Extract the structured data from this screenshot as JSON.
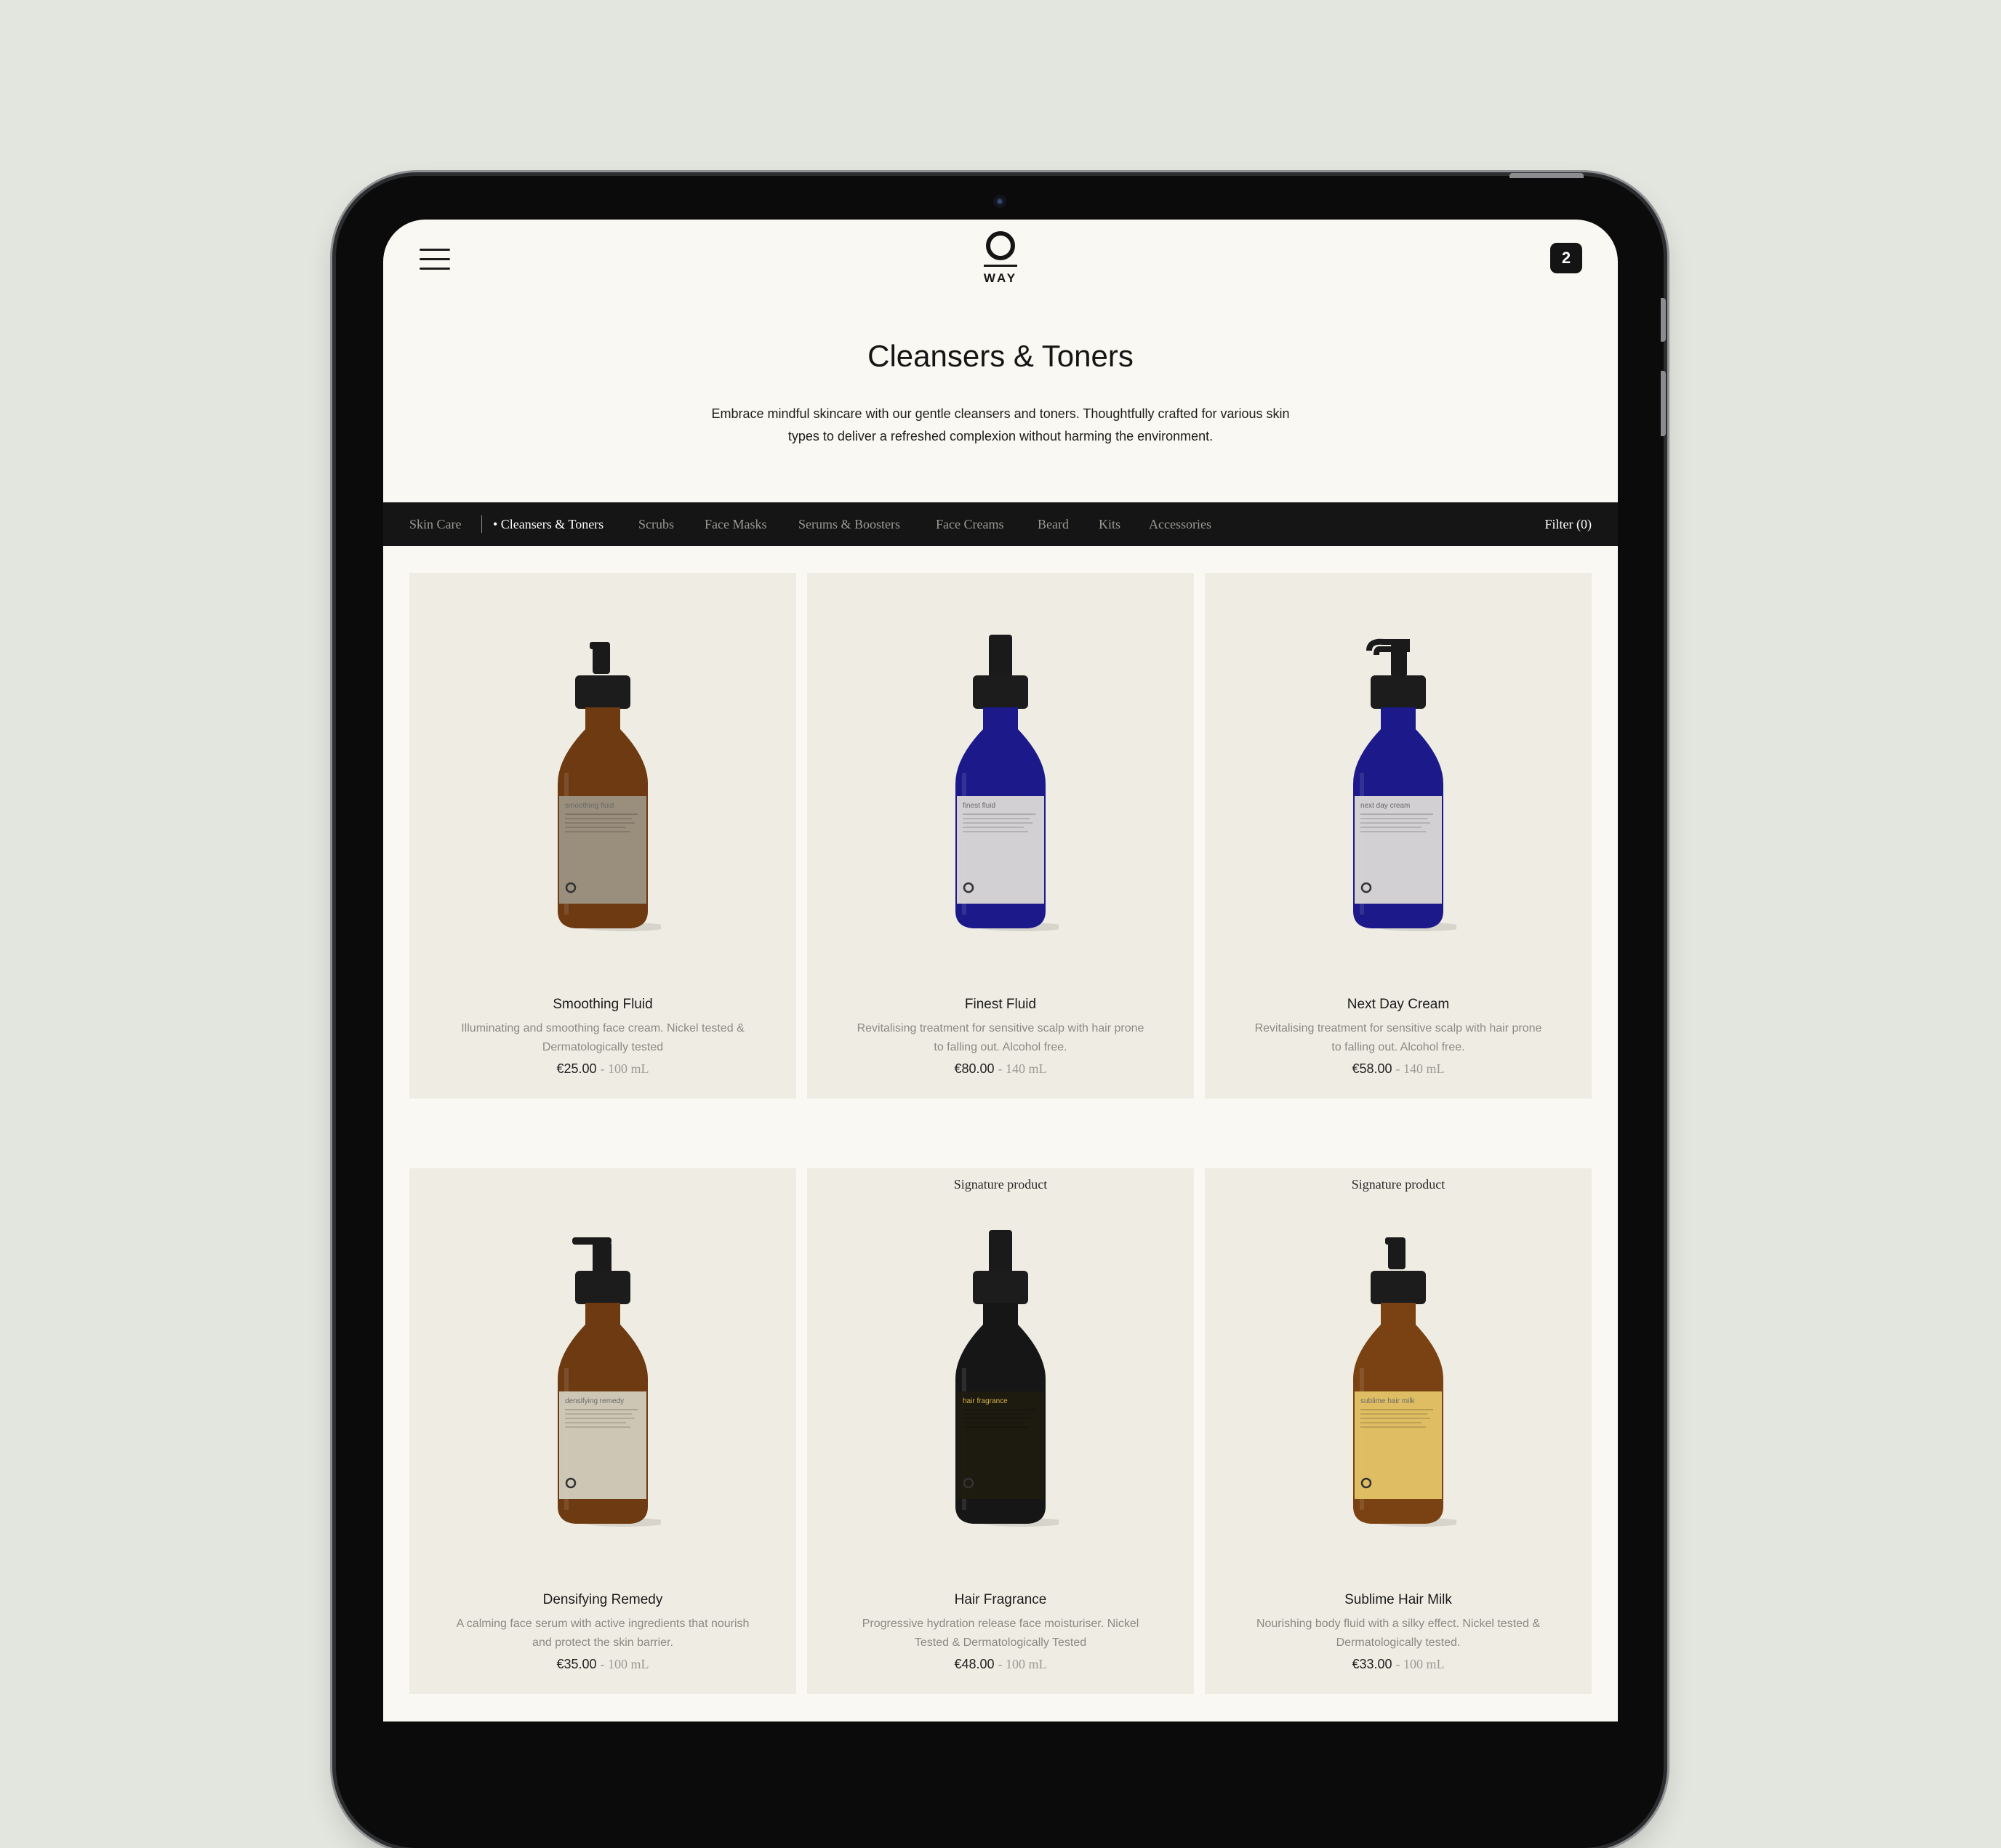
{
  "header": {
    "logo_text": "WAY",
    "cart_count": "2"
  },
  "page": {
    "title": "Cleansers & Toners",
    "intro_line1": "Embrace mindful skincare with our gentle cleansers and toners. Thoughtfully crafted for various skin",
    "intro_line2": "types to deliver a refreshed complexion without harming the environment."
  },
  "categories": {
    "parent": "Skin Care",
    "items": [
      "• Cleansers & Toners",
      "Scrubs",
      "Face Masks",
      "Serums & Boosters",
      "Face Creams",
      "Beard",
      "Kits",
      "Accessories"
    ],
    "active_index": 0,
    "filter_label": "Filter (0)"
  },
  "products": [
    {
      "badge": "",
      "name": "Smoothing Fluid",
      "description": "Illuminating and smoothing face cream. Nickel tested & Dermatologically tested",
      "price": "€25.00",
      "volume": "- 100 mL",
      "bottle": {
        "glass": "#6e3a12",
        "label": "#9c9283",
        "label_text": "smoothing fluid",
        "cap": "pump"
      }
    },
    {
      "badge": "",
      "name": "Finest Fluid",
      "description": "Revitalising treatment for sensitive scalp with hair prone to falling out. Alcohol free.",
      "price": "€80.00",
      "volume": "- 140 mL",
      "bottle": {
        "glass": "#1c1a8a",
        "label": "#dcdad6",
        "label_text": "finest fluid",
        "cap": "spray"
      }
    },
    {
      "badge": "",
      "name": "Next Day Cream",
      "description": "Revitalising treatment for sensitive scalp with hair prone to falling out. Alcohol free.",
      "price": "€58.00",
      "volume": "- 140 mL",
      "bottle": {
        "glass": "#1c1a8a",
        "label": "#dcdad6",
        "label_text": "next day cream",
        "cap": "pump-long"
      }
    },
    {
      "badge": "",
      "name": "Densifying Remedy",
      "description": "A calming face serum with active ingredients that nourish and protect the skin barrier.",
      "price": "€35.00",
      "volume": "- 100 mL",
      "bottle": {
        "glass": "#6e3a12",
        "label": "#d3cebf",
        "label_text": "densifying remedy",
        "cap": "nozzle"
      }
    },
    {
      "badge": "Signature product",
      "name": "Hair Fragrance",
      "description": "Progressive hydration release face moisturiser. Nickel Tested & Dermatologically Tested",
      "price": "€48.00",
      "volume": "- 100 mL",
      "bottle": {
        "glass": "#161616",
        "label": "#1e1a10",
        "label_text": "hair fragrance",
        "cap": "spray"
      }
    },
    {
      "badge": "Signature product",
      "name": "Sublime Hair Milk",
      "description": "Nourishing body fluid with a silky effect. Nickel tested & Dermatologically tested.",
      "price": "€33.00",
      "volume": "- 100 mL",
      "bottle": {
        "glass": "#7a4212",
        "label": "#e4c468",
        "label_text": "sublime hair milk",
        "cap": "pump"
      }
    }
  ]
}
